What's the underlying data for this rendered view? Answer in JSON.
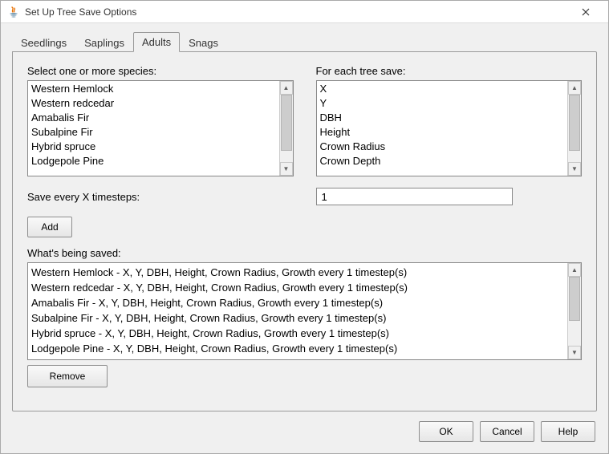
{
  "window": {
    "title": "Set Up Tree Save Options"
  },
  "tabs": [
    {
      "label": "Seedlings",
      "active": false
    },
    {
      "label": "Saplings",
      "active": false
    },
    {
      "label": "Adults",
      "active": true
    },
    {
      "label": "Snags",
      "active": false
    }
  ],
  "panel": {
    "species_label": "Select one or more species:",
    "species_list": [
      "Western Hemlock",
      "Western redcedar",
      "Amabalis Fir",
      "Subalpine Fir",
      "Hybrid spruce",
      "Lodgepole Pine"
    ],
    "save_fields_label": "For each tree save:",
    "save_fields_list": [
      "X",
      "Y",
      "DBH",
      "Height",
      "Crown Radius",
      "Crown Depth"
    ],
    "timestep_label": "Save every X timesteps:",
    "timestep_value": "1",
    "add_button": "Add",
    "saved_label": "What's being saved:",
    "saved_items": [
      "Western Hemlock - X, Y, DBH, Height, Crown Radius, Growth every 1 timestep(s)",
      "Western redcedar - X, Y, DBH, Height, Crown Radius, Growth every 1 timestep(s)",
      "Amabalis Fir - X, Y, DBH, Height, Crown Radius, Growth every 1 timestep(s)",
      "Subalpine Fir - X, Y, DBH, Height, Crown Radius, Growth every 1 timestep(s)",
      "Hybrid spruce - X, Y, DBH, Height, Crown Radius, Growth every 1 timestep(s)",
      "Lodgepole Pine - X, Y, DBH, Height, Crown Radius, Growth every 1 timestep(s)"
    ],
    "remove_button": "Remove"
  },
  "footer": {
    "ok": "OK",
    "cancel": "Cancel",
    "help": "Help"
  }
}
